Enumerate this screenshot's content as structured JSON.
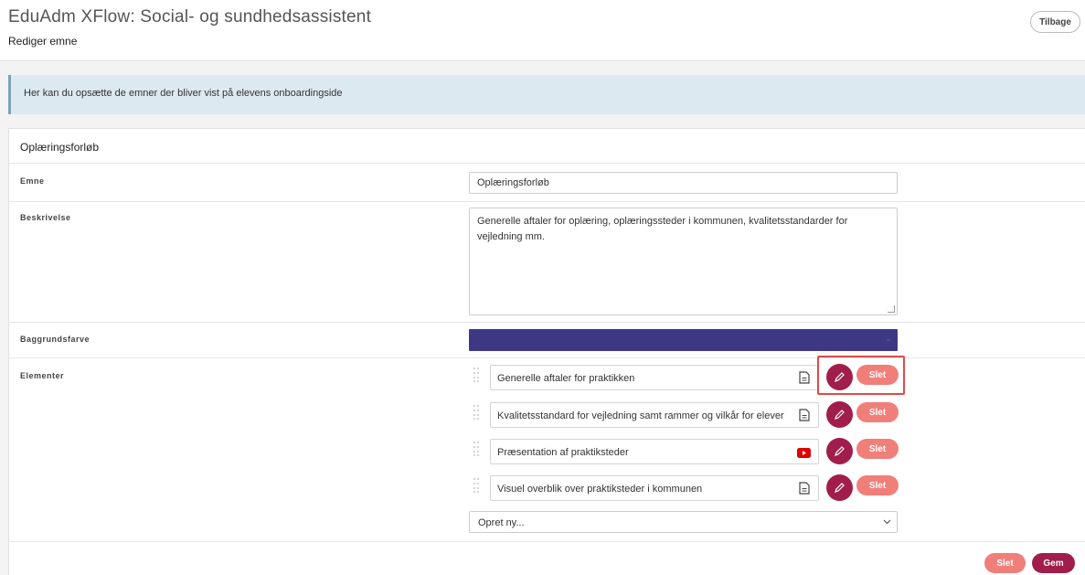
{
  "header": {
    "title": "EduAdm XFlow: Social- og sundhedsassistent",
    "subtitle": "Rediger emne",
    "back_label": "Tilbage"
  },
  "info_text": "Her kan du opsætte de emner der bliver vist på elevens onboardingside",
  "card": {
    "title": "Oplæringsforløb",
    "fields": {
      "topic_label": "Emne",
      "topic_value": "Oplæringsforløb",
      "description_label": "Beskrivelse",
      "description_value": "Generelle aftaler for oplæring, oplæringssteder i kommunen, kvalitetsstandarder for vejledning mm.",
      "bgcolor_label": "Baggrundsfarve",
      "bgcolor_value": "#3e3884",
      "elements_label": "Elementer"
    },
    "elements": [
      {
        "label": "Generelle aftaler for praktikken",
        "icon": "document-icon",
        "delete_label": "Slet"
      },
      {
        "label": "Kvalitetsstandard for vejledning samt rammer og vilkår for elever",
        "icon": "document-icon",
        "delete_label": "Slet"
      },
      {
        "label": "Præsentation af praktiksteder",
        "icon": "youtube-icon",
        "delete_label": "Slet"
      },
      {
        "label": "Visuel overblik over praktiksteder i kommunen",
        "icon": "document-icon",
        "delete_label": "Slet"
      }
    ],
    "new_element_placeholder": "Opret ny..."
  },
  "footer": {
    "delete_label": "Slet",
    "save_label": "Gem"
  },
  "colors": {
    "primary": "#a11d4b",
    "danger": "#f07f7a",
    "info_bg": "#dde9f0",
    "youtube": "#e00000"
  }
}
